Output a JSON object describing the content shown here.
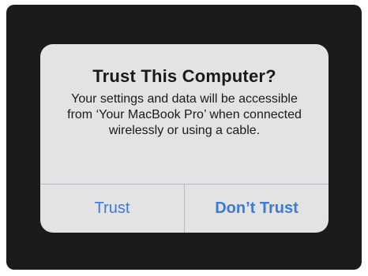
{
  "alert": {
    "title": "Trust This Computer?",
    "message": "Your settings and data will be accessible from ‘Your MacBook Pro’ when connected wirelessly or using a cable.",
    "buttons": {
      "trust": "Trust",
      "dont_trust": "Don’t Trust"
    }
  },
  "colors": {
    "screen_background": "#1b1b1d",
    "alert_background": "#e3e3e6",
    "button_text": "#3a7bd5",
    "title_text": "#1a1a1a"
  }
}
